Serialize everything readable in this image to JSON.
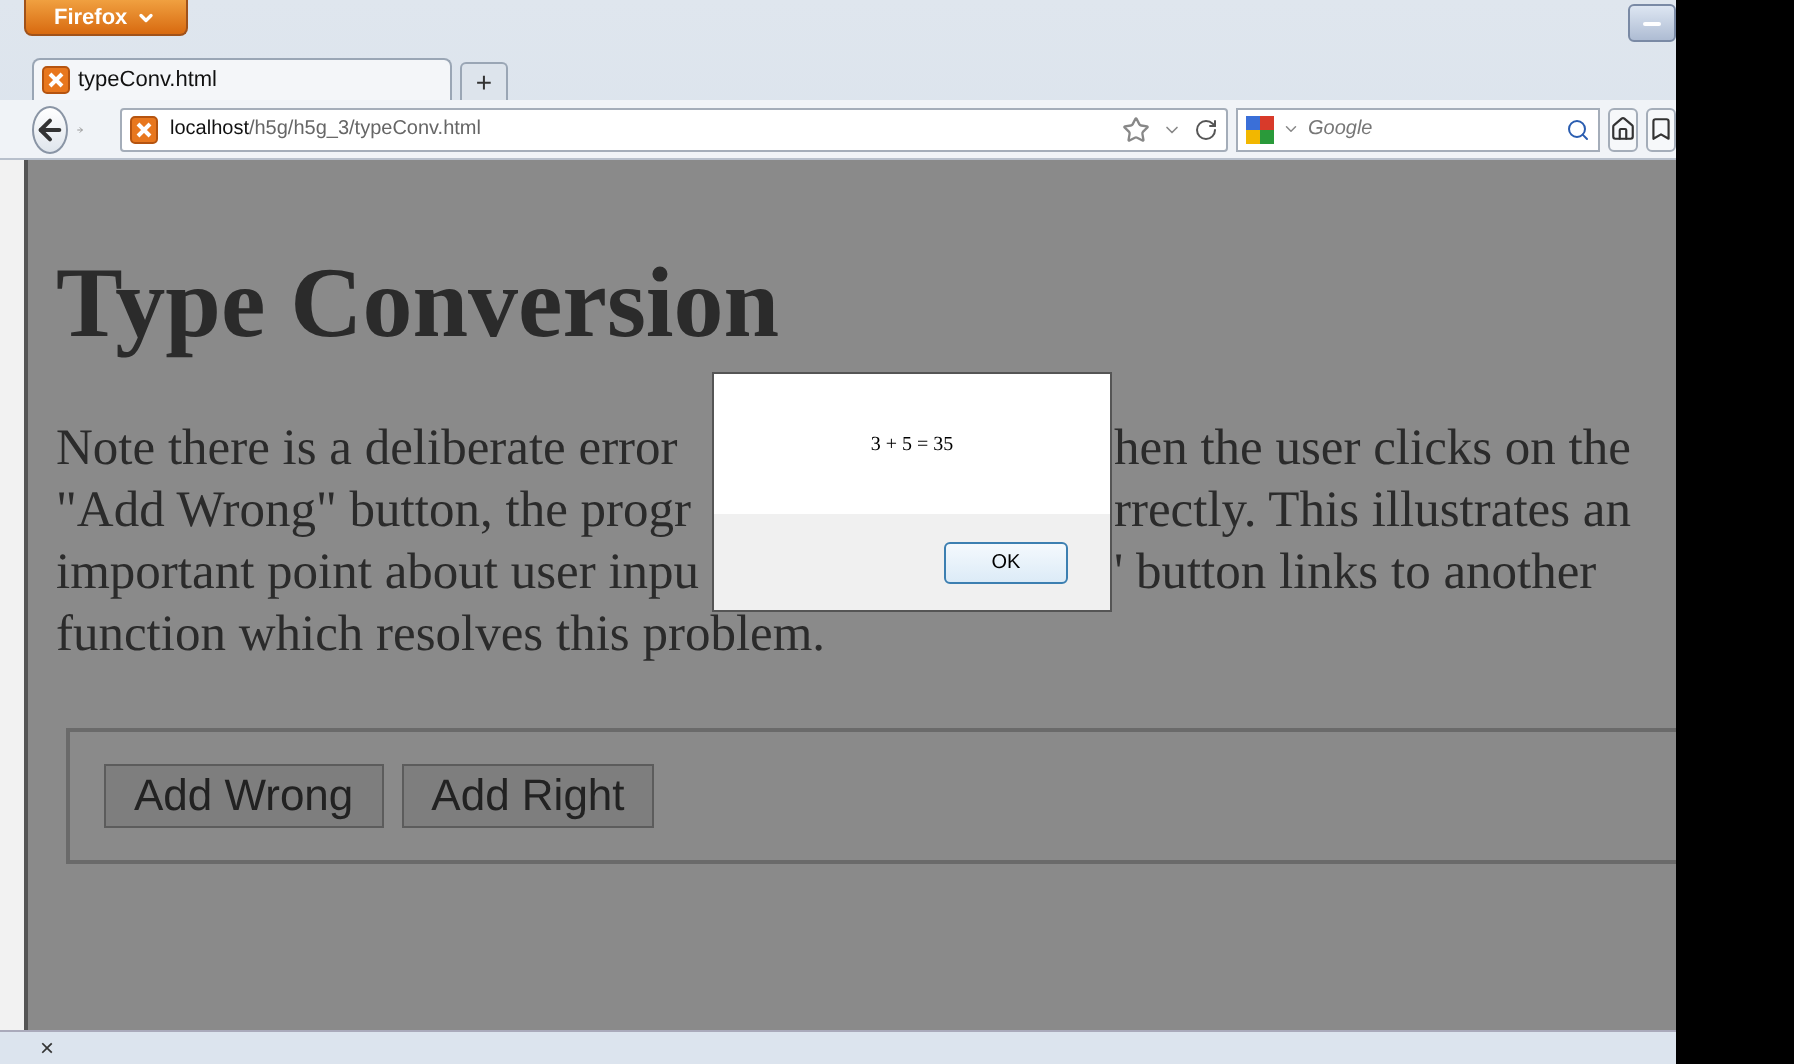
{
  "browser": {
    "app_button": "Firefox",
    "tab": {
      "title": "typeConv.html",
      "selected": true
    },
    "new_tab": "+",
    "address": {
      "host": "localhost",
      "path": "/h5g/h5g_3/typeConv.html"
    },
    "search": {
      "placeholder": "Google"
    }
  },
  "page": {
    "heading": "Type Conversion",
    "paragraph_lines": [
      {
        "left": "Note there is a deliberate error",
        "right": "hen the user clicks on the"
      },
      {
        "left": "\"Add Wrong\" button, the progr",
        "right": "rrectly. This illustrates an"
      },
      {
        "left": "important point about user inpu",
        "right": "' button links to another"
      },
      {
        "left": "function which resolves this problem."
      }
    ],
    "buttons": [
      "Add Wrong",
      "Add Right"
    ]
  },
  "dialog": {
    "message": "3 + 5 = 35",
    "button": "OK"
  },
  "status_bar": {
    "close": "×"
  }
}
